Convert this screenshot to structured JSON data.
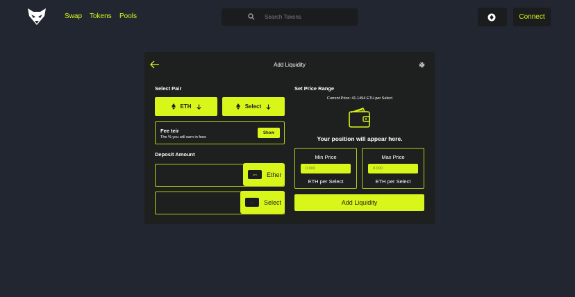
{
  "nav": {
    "logo_icon": "fox-logo-icon",
    "links": [
      {
        "label": "Swap"
      },
      {
        "label": "Tokens"
      },
      {
        "label": "Pools"
      }
    ],
    "search": {
      "placeholder": "Search Tokens",
      "icon": "search-icon"
    },
    "wallet_icon": "wallet-status-icon",
    "connect_label": "Connect"
  },
  "card": {
    "title": "Add Liquidity",
    "back_icon": "arrow-left-icon",
    "settings_icon": "gear-icon",
    "select_pair": {
      "label": "Select Pair",
      "token_a": "ETH",
      "token_b": "Select"
    },
    "fee": {
      "title": "Fee teir",
      "subtitle": "The % you will earn in fees",
      "button": "Show"
    },
    "deposit": {
      "label": "Deposit Amount",
      "rows": [
        {
          "token": "Ether",
          "chip": "ETH"
        },
        {
          "token": "Select",
          "chip": "---"
        }
      ]
    },
    "price_range": {
      "label": "Set Price Range",
      "current_price": "Current Price: 41.1494 ETH per Select",
      "empty_message": "Your position will appear here.",
      "min": {
        "label": "Min Price",
        "placeholder": "0.000",
        "unit": "ETH per Select"
      },
      "max": {
        "label": "Max Price",
        "placeholder": "0.000",
        "unit": "ETH per Select"
      }
    },
    "add_button": "Add Liquidity"
  },
  "colors": {
    "background": "#222631",
    "card": "#1e1f1f",
    "accent": "#d9f61a"
  }
}
